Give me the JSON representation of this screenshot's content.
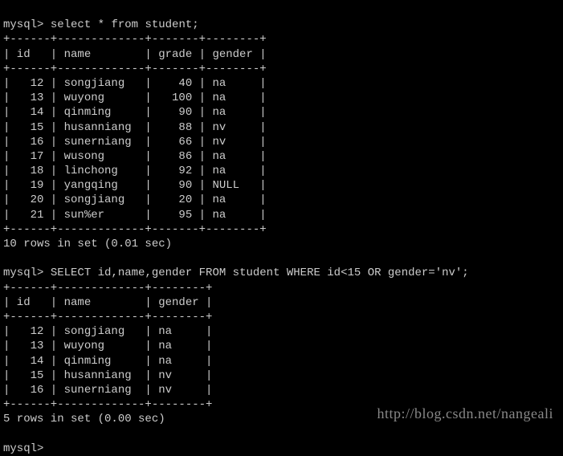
{
  "prompt": "mysql>",
  "query1": {
    "sql": "select * from student;",
    "border_top": "+------+-------------+-------+--------+",
    "header_row": "| id   | name        | grade | gender |",
    "border_mid": "+------+-------------+-------+--------+",
    "rows": [
      "|   12 | songjiang   |    40 | na     |",
      "|   13 | wuyong      |   100 | na     |",
      "|   14 | qinming     |    90 | na     |",
      "|   15 | husanniang  |    88 | nv     |",
      "|   16 | sunerniang  |    66 | nv     |",
      "|   17 | wusong      |    86 | na     |",
      "|   18 | linchong    |    92 | na     |",
      "|   19 | yangqing    |    90 | NULL   |",
      "|   20 | songjiang   |    20 | na     |",
      "|   21 | sun%er      |    95 | na     |"
    ],
    "border_bot": "+------+-------------+-------+--------+",
    "status": "10 rows in set (0.01 sec)"
  },
  "query2": {
    "sql": "SELECT id,name,gender FROM student WHERE id<15 OR gender='nv';",
    "border_top": "+------+-------------+--------+",
    "header_row": "| id   | name        | gender |",
    "border_mid": "+------+-------------+--------+",
    "rows": [
      "|   12 | songjiang   | na     |",
      "|   13 | wuyong      | na     |",
      "|   14 | qinming     | na     |",
      "|   15 | husanniang  | nv     |",
      "|   16 | sunerniang  | nv     |"
    ],
    "border_bot": "+------+-------------+--------+",
    "status": "5 rows in set (0.00 sec)"
  },
  "final_prompt": "mysql>",
  "watermark": "http://blog.csdn.net/nangeali",
  "chart_data": [
    {
      "type": "table",
      "title": "student (full)",
      "columns": [
        "id",
        "name",
        "grade",
        "gender"
      ],
      "rows": [
        [
          12,
          "songjiang",
          40,
          "na"
        ],
        [
          13,
          "wuyong",
          100,
          "na"
        ],
        [
          14,
          "qinming",
          90,
          "na"
        ],
        [
          15,
          "husanniang",
          88,
          "nv"
        ],
        [
          16,
          "sunerniang",
          66,
          "nv"
        ],
        [
          17,
          "wusong",
          86,
          "na"
        ],
        [
          18,
          "linchong",
          92,
          "na"
        ],
        [
          19,
          "yangqing",
          90,
          null
        ],
        [
          20,
          "songjiang",
          20,
          "na"
        ],
        [
          21,
          "sun%er",
          95,
          "na"
        ]
      ]
    },
    {
      "type": "table",
      "title": "student (id<15 OR gender='nv')",
      "columns": [
        "id",
        "name",
        "gender"
      ],
      "rows": [
        [
          12,
          "songjiang",
          "na"
        ],
        [
          13,
          "wuyong",
          "na"
        ],
        [
          14,
          "qinming",
          "na"
        ],
        [
          15,
          "husanniang",
          "nv"
        ],
        [
          16,
          "sunerniang",
          "nv"
        ]
      ]
    }
  ]
}
